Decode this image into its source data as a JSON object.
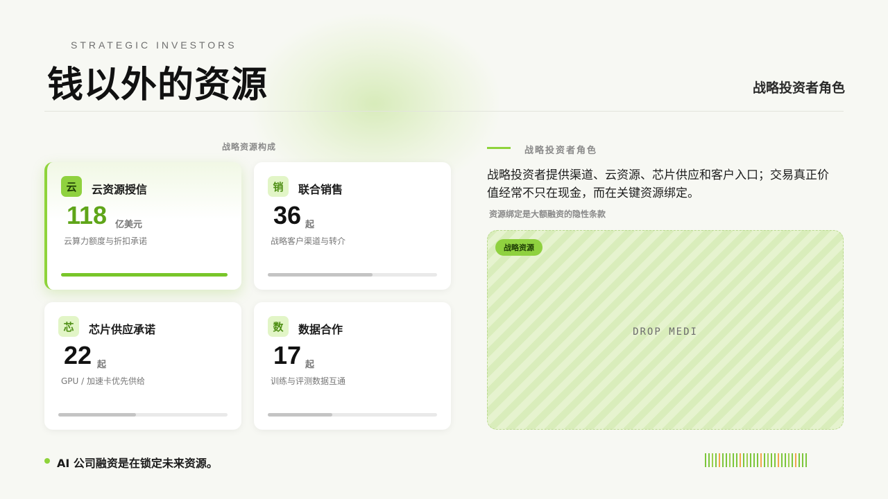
{
  "header": {
    "eyebrow": "STRATEGIC INVESTORS",
    "title": "钱以外的资源",
    "right_label": "战略投资者角色"
  },
  "resources": {
    "caption": "战略资源构成",
    "cards": [
      {
        "badge": "云",
        "name": "云资源授信",
        "value": "118",
        "unit": "亿美元",
        "desc": "云算力额度与折扣承诺",
        "progress": 1.0,
        "active": true
      },
      {
        "badge": "销",
        "name": "联合销售",
        "value": "36",
        "unit": "起",
        "desc": "战略客户渠道与转介",
        "progress": 0.62,
        "active": false
      },
      {
        "badge": "芯",
        "name": "芯片供应承诺",
        "value": "22",
        "unit": "起",
        "desc": "GPU / 加速卡优先供给",
        "progress": 0.46,
        "active": false
      },
      {
        "badge": "数",
        "name": "数据合作",
        "value": "17",
        "unit": "起",
        "desc": "训练与评测数据互通",
        "progress": 0.38,
        "active": false
      }
    ]
  },
  "side": {
    "label": "战略投资者角色",
    "text": "战略投资者提供渠道、云资源、芯片供应和客户入口；交易真正价值经常不只在现金，而在关键资源绑定。",
    "sub": "资源绑定是大额融资的隐性条款",
    "media_tag": "战略资源",
    "media_placeholder": "DROP MEDI"
  },
  "footer": {
    "text": "AI  公司融资是在锁定未来资源。"
  },
  "colors": {
    "accent": "#8ed33a",
    "accent_dark": "#5fa519",
    "background": "#f7f8f3",
    "barcode": [
      "#7cc63a",
      "#f0a64a",
      "#9ad04e"
    ]
  }
}
